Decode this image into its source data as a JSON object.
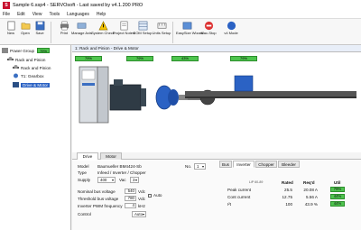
{
  "window": {
    "title": "Sample 6.ssp4 - SERVOsoft - Last saved by v4.1.200 PRO",
    "app_icon_text": "S"
  },
  "menu": [
    "File",
    "Edit",
    "View",
    "Tools",
    "Languages",
    "Help"
  ],
  "ribbon": [
    {
      "label": "New",
      "icon": "new-icon"
    },
    {
      "label": "Open",
      "icon": "open-icon"
    },
    {
      "label": "Save",
      "icon": "save-icon"
    },
    {
      "label": "Print",
      "icon": "print-icon"
    },
    {
      "label": "Manage Axis",
      "icon": "manage-axis-icon"
    },
    {
      "label": "System Check",
      "icon": "system-check-icon"
    },
    {
      "label": "Project Notes",
      "icon": "project-notes-icon"
    },
    {
      "label": "BOM Setup",
      "icon": "bom-icon"
    },
    {
      "label": "Units Setup",
      "icon": "units-icon"
    },
    {
      "label": "EasySize Wizard",
      "icon": "wizard-icon"
    },
    {
      "label": "Mac-Stop",
      "icon": "stop-icon"
    },
    {
      "label": "v4 Mode",
      "icon": "mode-icon"
    }
  ],
  "tree": {
    "power_group": {
      "label": "Power Group",
      "pct": "79%"
    },
    "rack_pinion_top": "Rack and Pinion",
    "rack_pinion_inner": "Rack and Pinion",
    "gearbox": "T1: Gearbox",
    "drive_motor": "Drive & Motor"
  },
  "canvas": {
    "header": "1: Rack and Pinion - Drive & Motor",
    "util_bars": [
      "79%",
      "79%",
      "43%",
      "79%"
    ]
  },
  "tabs": {
    "drive": "Drive",
    "motor": "Motor"
  },
  "form": {
    "model_label": "Model",
    "model_value": "Baumueller BM4424-Sb",
    "type_label": "Type",
    "type_value": "Infeed / Inverter / Chopper",
    "supply_label": "Supply",
    "supply_value": "400",
    "supply_unit": "Vac",
    "supply_phase": "3",
    "nominal_label": "Nominal bus voltage",
    "nominal_value": "540",
    "nominal_unit": "Vdc",
    "threshold_label": "Threshold bus voltage",
    "threshold_value": "780",
    "threshold_unit": "Vdc",
    "pwm_label": "Inverter PWM frequency",
    "pwm_value": "4",
    "pwm_unit": "kHz",
    "auto_label": "Auto",
    "control_label": "Control",
    "control_value": "Auto",
    "no_label": "No.",
    "no_value": "1"
  },
  "subtabs": {
    "bus": "Bus",
    "inverter": "Inverter",
    "chopper": "Chopper",
    "bleeder": "Bleeder"
  },
  "results": {
    "headers": {
      "col1": "Rated",
      "col2": "Req'd",
      "col3": "Util"
    },
    "hint": "LiP 60-89",
    "rows": [
      {
        "name": "Peak current",
        "rated": "25.5",
        "reqd": "20.08 A",
        "util": "79%"
      },
      {
        "name": "Cont current",
        "rated": "12.75",
        "reqd": "5.56 A",
        "util": "44%"
      },
      {
        "name": "I²t",
        "rated": "100",
        "reqd": "43.9 %",
        "util": "44%"
      }
    ]
  }
}
